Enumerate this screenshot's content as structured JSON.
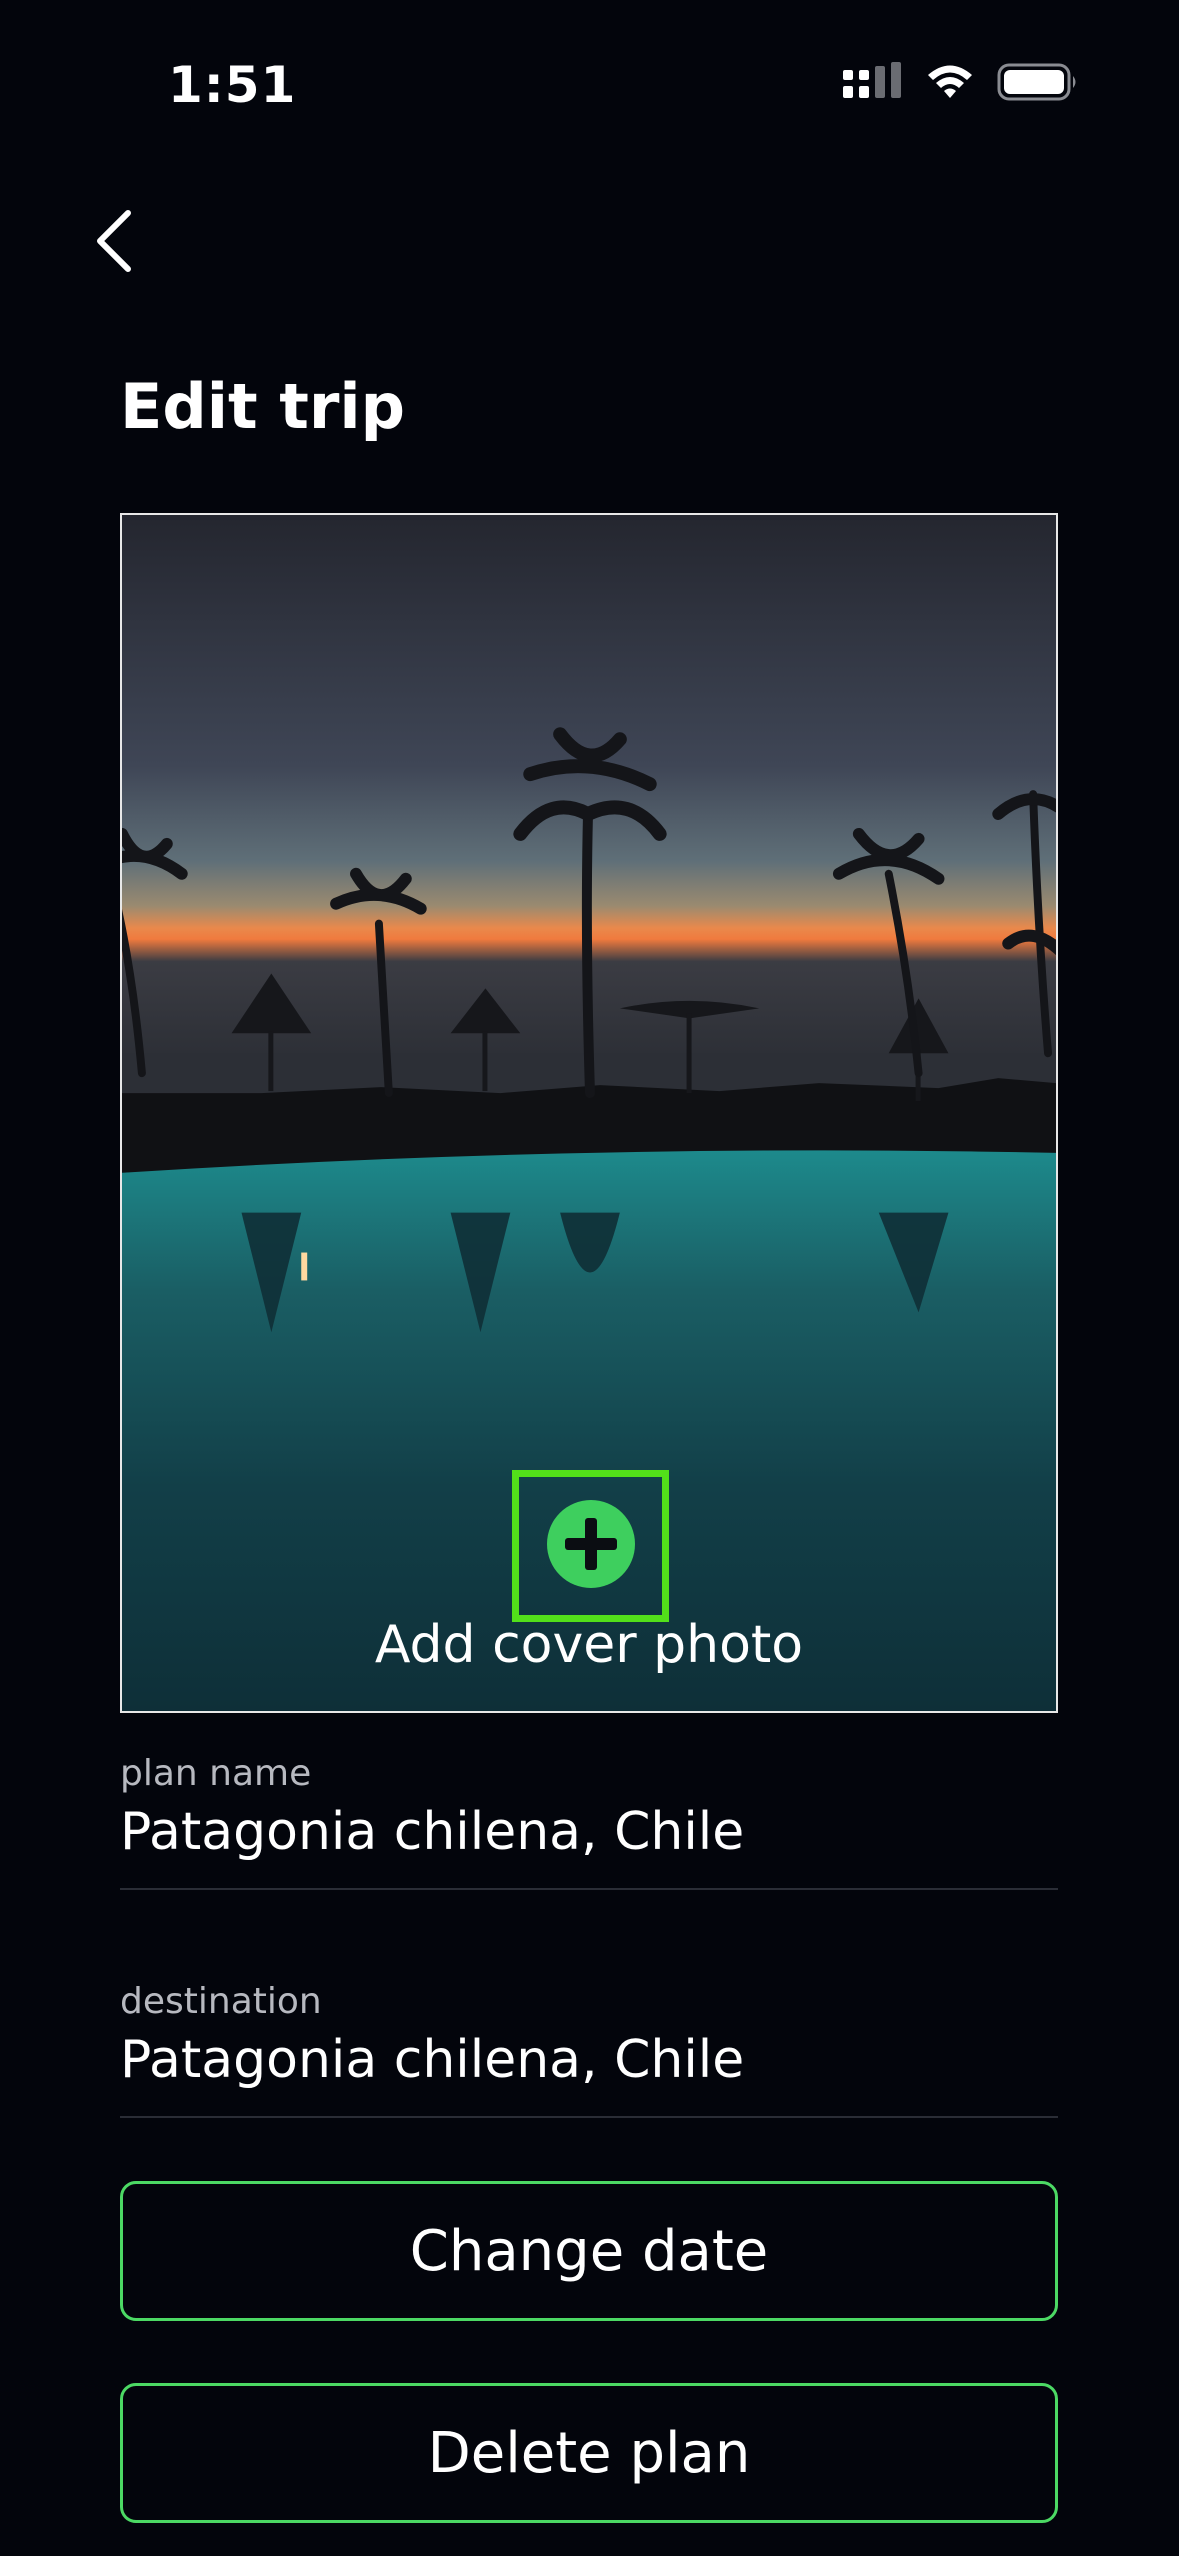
{
  "status_bar": {
    "time": "1:51",
    "icons": [
      "cellular-signal-icon",
      "wifi-icon",
      "battery-icon"
    ]
  },
  "header": {
    "back_icon": "chevron-left-icon",
    "title": "Edit trip"
  },
  "cover": {
    "add_icon": "plus-circle-icon",
    "add_label": "Add cover photo"
  },
  "fields": {
    "plan_name": {
      "label": "plan name",
      "value": "Patagonia chilena, Chile"
    },
    "destination": {
      "label": "destination",
      "value": "Patagonia chilena, Chile"
    }
  },
  "actions": {
    "change_date": "Change date",
    "delete_plan": "Delete plan"
  },
  "colors": {
    "background": "#03050c",
    "accent_green": "#4cd964",
    "highlight_green": "#52e01a",
    "icon_green": "#3ecf5e"
  }
}
